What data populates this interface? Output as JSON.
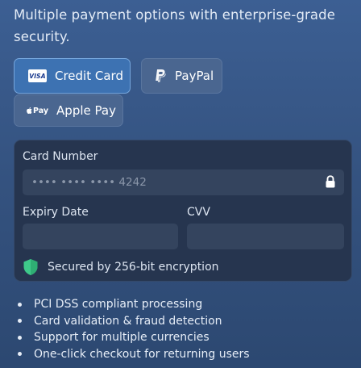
{
  "intro": {
    "text": "Multiple payment options with enterprise-grade security."
  },
  "payment_methods": [
    {
      "label": "Credit Card",
      "icon": "visa-card-icon",
      "badge_text": "VISA",
      "selected": true
    },
    {
      "label": "PayPal",
      "icon": "paypal-icon",
      "selected": false
    },
    {
      "label": "Apple Pay",
      "icon": "apple-pay-icon",
      "icon_text": "Pay",
      "selected": false
    }
  ],
  "card_form": {
    "card_number_label": "Card Number",
    "card_number_placeholder": "•••• •••• •••• 4242",
    "card_number_icon": "lock-icon",
    "expiry_label": "Expiry Date",
    "expiry_value": "",
    "cvv_label": "CVV",
    "cvv_value": "",
    "security_text": "Secured by 256-bit encryption",
    "security_icon": "shield-icon"
  },
  "features": [
    "PCI DSS compliant processing",
    "Card validation & fraud detection",
    "Support for multiple currencies",
    "One-click checkout for returning users"
  ],
  "colors": {
    "background_top": "#3c5f93",
    "background_bottom": "#2c4871",
    "selected_button": "#3d72b2",
    "unselected_button": "#4a6690",
    "panel": "#26354f",
    "field": "#34445e",
    "shield": "#3ec98a"
  }
}
